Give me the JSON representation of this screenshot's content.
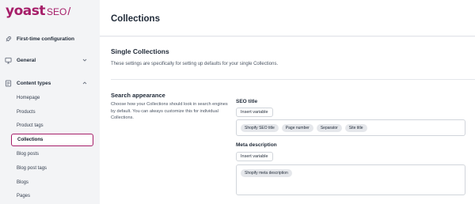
{
  "logo": {
    "brand": "yoast",
    "product": "SEO",
    "slash": "/"
  },
  "sidebar": {
    "items": [
      {
        "label": "First-time configuration",
        "icon": "rocket-icon"
      },
      {
        "label": "General",
        "icon": "desktop-icon",
        "chevron": "chevron-down-icon"
      },
      {
        "label": "Content types",
        "icon": "document-icon",
        "chevron": "chevron-up-icon"
      }
    ],
    "subitems": [
      "Homepage",
      "Products",
      "Product tags",
      "Collections",
      "Blog posts",
      "Blog post tags",
      "Blogs",
      "Pages"
    ],
    "active_subitem": "Collections"
  },
  "header": {
    "title": "Collections"
  },
  "main": {
    "section_title": "Single Collections",
    "section_desc": "These settings are specifically for setting up defaults for your single Collections.",
    "search_appearance": {
      "title": "Search appearance",
      "desc": "Choose how your Collections should look in search engines by default. You can always customize this for individual Collections."
    },
    "seo_title": {
      "label": "SEO title",
      "insert_label": "Insert variable",
      "chips": [
        "Shopify SEO title",
        "Page number",
        "Separator",
        "Site title"
      ]
    },
    "meta_description": {
      "label": "Meta description",
      "insert_label": "Insert variable",
      "chips": [
        "Shopify meta description"
      ]
    }
  },
  "colors": {
    "brand": "#a61e69"
  }
}
